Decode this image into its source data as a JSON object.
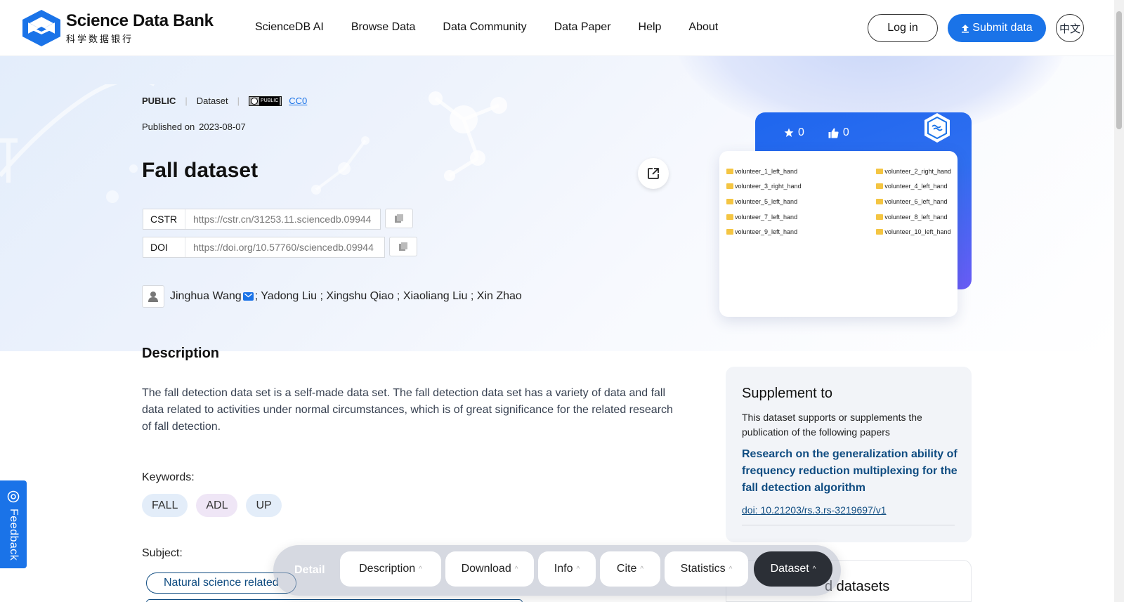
{
  "header": {
    "logo_en": "Science Data Bank",
    "logo_cn": "科学数据银行",
    "nav": [
      "ScienceDB AI",
      "Browse Data",
      "Data Community",
      "Data Paper",
      "Help",
      "About"
    ],
    "login": "Log in",
    "submit": "Submit data",
    "lang": "中文"
  },
  "meta": {
    "visibility": "PUBLIC",
    "type": "Dataset",
    "license": "CC0",
    "published_label": "Published on",
    "published_date": "2023-08-07"
  },
  "dataset": {
    "title": "Fall dataset",
    "cstr_label": "CSTR",
    "cstr_value": "https://cstr.cn/31253.11.sciencedb.09944",
    "doi_label": "DOI",
    "doi_value": "https://doi.org/10.57760/sciencedb.09944",
    "first_author": "Jinghua Wang",
    "other_authors": "; Yadong Liu ; Xingshu Qiao ; Xiaoliang Liu ; Xin Zhao"
  },
  "card": {
    "stars": "0",
    "likes": "0",
    "folders": [
      "volunteer_1_left_hand",
      "volunteer_2_right_hand",
      "volunteer_3_right_hand",
      "volunteer_4_left_hand",
      "volunteer_5_left_hand",
      "volunteer_6_left_hand",
      "volunteer_7_left_hand",
      "volunteer_8_left_hand",
      "volunteer_9_left_hand",
      "volunteer_10_left_hand"
    ]
  },
  "description": {
    "heading": "Description",
    "text": "The fall detection data set is a self-made data set. The fall detection data set has a variety of data and fall data related to activities under normal circumstances, which is of great significance for the related research of fall detection.",
    "keywords_label": "Keywords:",
    "keywords": [
      "FALL",
      "ADL",
      "UP"
    ],
    "keyword_colors": [
      "#e3edf9",
      "#efe6f6",
      "#e3edf9"
    ],
    "subject_label": "Subject:",
    "subject": "Natural science related"
  },
  "supplement": {
    "heading": "Supplement to",
    "sub": "This dataset supports or supplements the publication of the following papers",
    "paper_title": "Research on the generalization ability of frequency reduction multiplexing for the fall detection algorithm",
    "doi": "doi: 10.21203/rs.3.rs-3219697/v1"
  },
  "related": {
    "heading_partial": "d datasets"
  },
  "feedback": "Feedback",
  "tabbar": {
    "detail": "Detail",
    "tabs": [
      "Description",
      "Download",
      "Info",
      "Cite",
      "Statistics",
      "Dataset"
    ]
  },
  "colors": {
    "accent": "#1a73e8",
    "dark_blue": "#0f4c81",
    "tab_active": "#2b2f36"
  }
}
